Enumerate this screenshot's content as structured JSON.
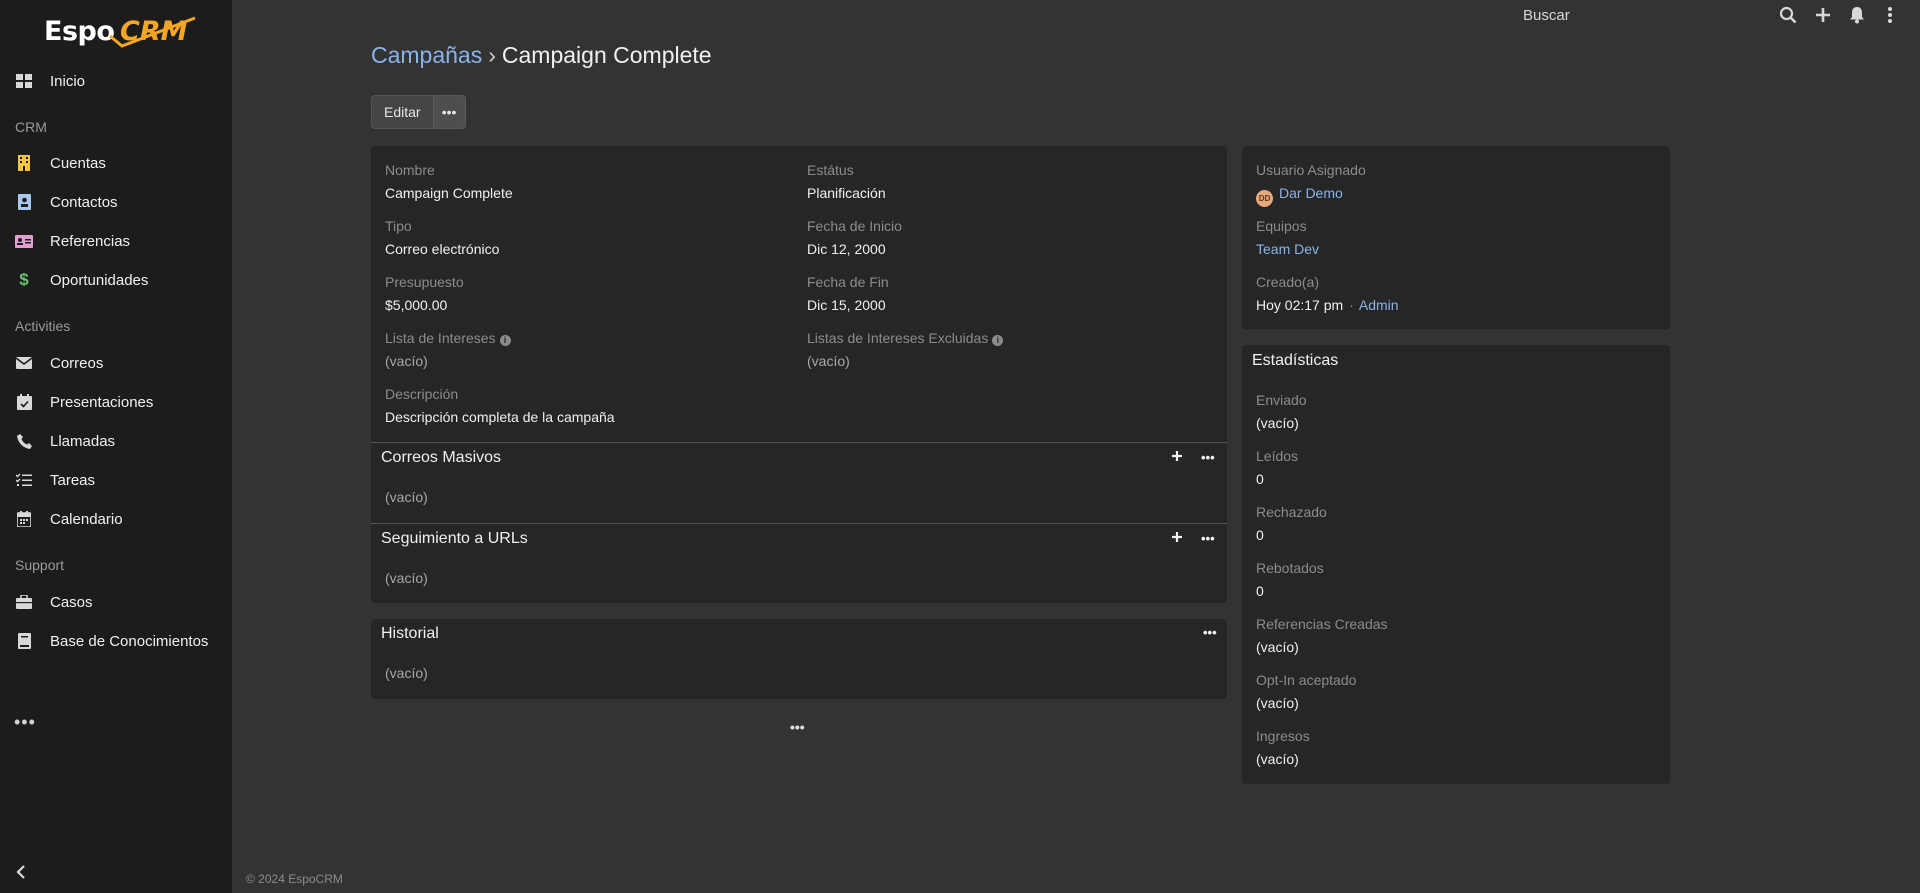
{
  "app": {
    "logo_text_main": "Espo",
    "logo_text_accent": "CRM",
    "colors": {
      "accent": "#f5a623",
      "link": "#8ab4e8",
      "sidebar_bg": "#1c1c1c",
      "page_bg": "#333333",
      "panel_bg": "#262626"
    }
  },
  "sidebar": {
    "home": {
      "label": "Inicio",
      "icon": "grid-icon"
    },
    "groups": {
      "crm": "CRM",
      "activities": "Activities",
      "support": "Support"
    },
    "items": [
      {
        "label": "Cuentas",
        "icon": "building-icon",
        "color": "#f5c542"
      },
      {
        "label": "Contactos",
        "icon": "contact-card-icon",
        "color": "#a8c8f0"
      },
      {
        "label": "Referencias",
        "icon": "id-card-icon",
        "color": "#e0a0d0"
      },
      {
        "label": "Oportunidades",
        "icon": "dollar-icon",
        "color": "#6cc070"
      },
      {
        "label": "Correos",
        "icon": "envelope-icon",
        "color": "#d8d8d8"
      },
      {
        "label": "Presentaciones",
        "icon": "calendar-check-icon",
        "color": "#d8d8d8"
      },
      {
        "label": "Llamadas",
        "icon": "phone-icon",
        "color": "#d8d8d8"
      },
      {
        "label": "Tareas",
        "icon": "tasks-icon",
        "color": "#d8d8d8"
      },
      {
        "label": "Calendario",
        "icon": "calendar-icon",
        "color": "#d8d8d8"
      },
      {
        "label": "Casos",
        "icon": "briefcase-icon",
        "color": "#d8d8d8"
      },
      {
        "label": "Base de Conocimientos",
        "icon": "book-icon",
        "color": "#d8d8d8"
      }
    ],
    "more": "•••"
  },
  "topbar": {
    "search_placeholder": "Buscar"
  },
  "breadcrumb": {
    "parent": "Campañas",
    "separator": "›",
    "current": "Campaign Complete"
  },
  "actions": {
    "edit": "Editar",
    "more": "•••"
  },
  "detail": {
    "nombre_label": "Nombre",
    "nombre_value": "Campaign Complete",
    "estatus_label": "Estátus",
    "estatus_value": "Planificación",
    "tipo_label": "Tipo",
    "tipo_value": "Correo electrónico",
    "fecha_inicio_label": "Fecha de Inicio",
    "fecha_inicio_value": "Dic 12, 2000",
    "presupuesto_label": "Presupuesto",
    "presupuesto_value": "$5,000.00",
    "fecha_fin_label": "Fecha de Fin",
    "fecha_fin_value": "Dic 15, 2000",
    "lista_intereses_label": "Lista de Intereses",
    "lista_intereses_value": "(vacío)",
    "listas_excluidas_label": "Listas de Intereses Excluidas",
    "listas_excluidas_value": "(vacío)",
    "descripcion_label": "Descripción",
    "descripcion_value": "Descripción completa de la campaña"
  },
  "relationships": {
    "correos_masivos_title": "Correos Masivos",
    "correos_masivos_value": "(vacío)",
    "seguimiento_title": "Seguimiento a URLs",
    "seguimiento_value": "(vacío)",
    "historial_title": "Historial",
    "historial_value": "(vacío)"
  },
  "side": {
    "usuario_label": "Usuario Asignado",
    "usuario_avatar": "DD",
    "usuario_value": "Dar Demo",
    "equipos_label": "Equipos",
    "equipos_value": "Team Dev",
    "creado_label": "Creado(a)",
    "creado_value": "Hoy 02:17 pm",
    "creado_sep": "·",
    "creado_by": "Admin"
  },
  "stats": {
    "title": "Estadísticas",
    "enviado_label": "Enviado",
    "enviado_value": "(vacío)",
    "leidos_label": "Leídos",
    "leidos_value": "0",
    "rechazado_label": "Rechazado",
    "rechazado_value": "0",
    "rebotados_label": "Rebotados",
    "rebotados_value": "0",
    "referencias_label": "Referencias Creadas",
    "referencias_value": "(vacío)",
    "optin_label": "Opt-In aceptado",
    "optin_value": "(vacío)",
    "ingresos_label": "Ingresos",
    "ingresos_value": "(vacío)"
  },
  "footer": {
    "more": "•••",
    "copyright": "© 2024 EspoCRM"
  }
}
